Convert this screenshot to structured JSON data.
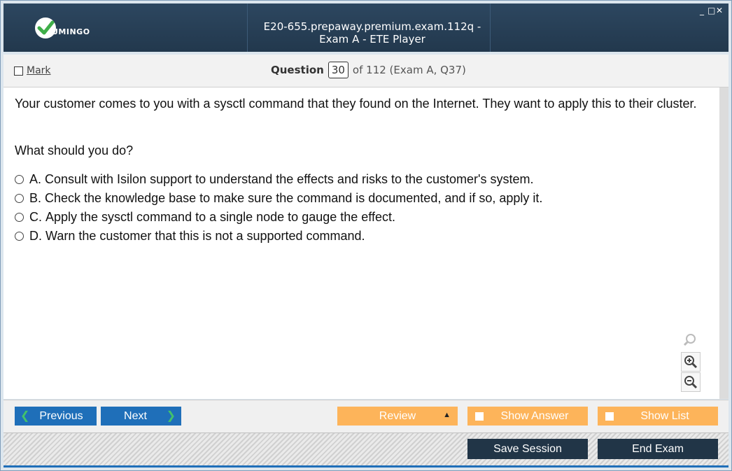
{
  "window": {
    "title": "E20-655.prepaway.premium.exam.112q - Exam A - ETE Player",
    "logo_text": "UMINGO",
    "controls": [
      "_",
      "□",
      "✕"
    ]
  },
  "header": {
    "mark_label": "Mark",
    "question_label": "Question",
    "question_number": "30",
    "question_total": "of 112 (Exam A, Q37)"
  },
  "question": {
    "text": "Your customer comes to you with a sysctl command that they found on the Internet. They want to apply this to their cluster.",
    "prompt": "What should you do?",
    "answers": [
      {
        "letter": "A.",
        "text": "Consult with Isilon support to understand the effects and risks to the customer's system."
      },
      {
        "letter": "B.",
        "text": "Check the knowledge base to make sure the command is documented, and if so, apply it."
      },
      {
        "letter": "C.",
        "text": "Apply the sysctl command to a single node to gauge the effect."
      },
      {
        "letter": "D.",
        "text": "Warn the customer that this is not a supported command."
      }
    ]
  },
  "zoom": {
    "icons": [
      "zoom-reset-icon",
      "zoom-in-icon",
      "zoom-out-icon"
    ]
  },
  "nav": {
    "previous": "Previous",
    "next": "Next",
    "review": "Review",
    "show_answer": "Show Answer",
    "show_list": "Show List",
    "save_session": "Save Session",
    "end_exam": "End Exam"
  },
  "colors": {
    "title_bg": "#22384d",
    "nav_blue": "#1f6fb9",
    "orange": "#fdb45a",
    "dark_button": "#213547",
    "chevron_green": "#43c26b"
  }
}
